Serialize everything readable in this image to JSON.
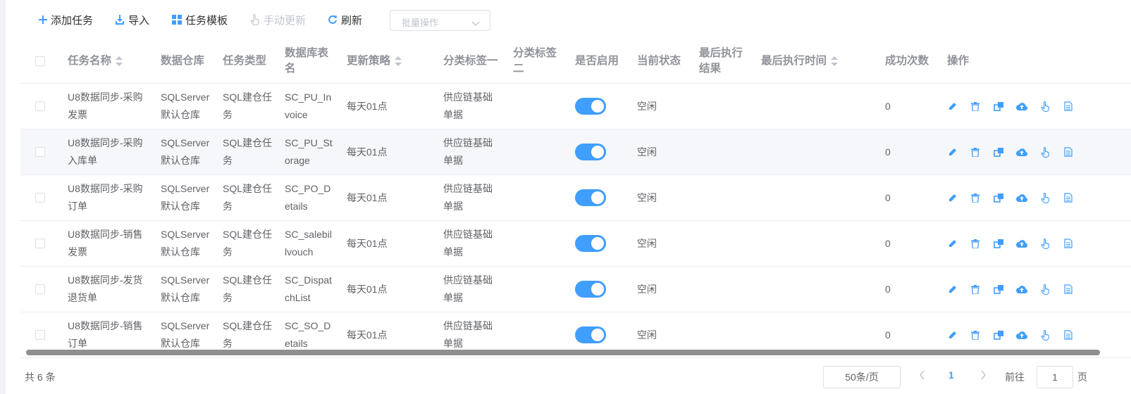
{
  "toolbar": {
    "add_label": "添加任务",
    "import_label": "导入",
    "template_label": "任务模板",
    "manual_update_label": "手动更新",
    "refresh_label": "刷新",
    "batch_placeholder": "批量操作"
  },
  "columns": {
    "task_name": "任务名称",
    "warehouse": "数据仓库",
    "task_type": "任务类型",
    "db_table_1": "数据库表",
    "db_table_2": "名",
    "strategy": "更新策略",
    "tag1": "分类标签一",
    "tag2_1": "分类标签",
    "tag2_2": "二",
    "enabled": "是否启用",
    "status": "当前状态",
    "last_result_1": "最后执行",
    "last_result_2": "结果",
    "last_time": "最后执行时间",
    "success_count": "成功次数",
    "ops": "操作"
  },
  "rows": [
    {
      "name1": "U8数据同步-采购",
      "name2": "发票",
      "wh1": "SQLServer",
      "wh2": "默认仓库",
      "type1": "SQL建仓任",
      "type2": "务",
      "tbl1": "SC_PU_In",
      "tbl2": "voice",
      "strategy": "每天01点",
      "tag1_1": "供应链基础",
      "tag1_2": "单据",
      "enabled": true,
      "status": "空闲",
      "success": "0"
    },
    {
      "name1": "U8数据同步-采购",
      "name2": "入库单",
      "wh1": "SQLServer",
      "wh2": "默认仓库",
      "type1": "SQL建仓任",
      "type2": "务",
      "tbl1": "SC_PU_St",
      "tbl2": "orage",
      "strategy": "每天01点",
      "tag1_1": "供应链基础",
      "tag1_2": "单据",
      "enabled": true,
      "status": "空闲",
      "success": "0"
    },
    {
      "name1": "U8数据同步-采购",
      "name2": "订单",
      "wh1": "SQLServer",
      "wh2": "默认仓库",
      "type1": "SQL建仓任",
      "type2": "务",
      "tbl1": "SC_PO_D",
      "tbl2": "etails",
      "strategy": "每天01点",
      "tag1_1": "供应链基础",
      "tag1_2": "单据",
      "enabled": true,
      "status": "空闲",
      "success": "0"
    },
    {
      "name1": "U8数据同步-销售",
      "name2": "发票",
      "wh1": "SQLServer",
      "wh2": "默认仓库",
      "type1": "SQL建仓任",
      "type2": "务",
      "tbl1": "SC_salebil",
      "tbl2": "lvouch",
      "strategy": "每天01点",
      "tag1_1": "供应链基础",
      "tag1_2": "单据",
      "enabled": true,
      "status": "空闲",
      "success": "0"
    },
    {
      "name1": "U8数据同步-发货",
      "name2": "退货单",
      "wh1": "SQLServer",
      "wh2": "默认仓库",
      "type1": "SQL建仓任",
      "type2": "务",
      "tbl1": "SC_Dispat",
      "tbl2": "chList",
      "strategy": "每天01点",
      "tag1_1": "供应链基础",
      "tag1_2": "单据",
      "enabled": true,
      "status": "空闲",
      "success": "0"
    },
    {
      "name1": "U8数据同步-销售",
      "name2": "订单",
      "wh1": "SQLServer",
      "wh2": "默认仓库",
      "type1": "SQL建仓任",
      "type2": "务",
      "tbl1": "SC_SO_D",
      "tbl2": "etails",
      "strategy": "每天01点",
      "tag1_1": "供应链基础",
      "tag1_2": "单据",
      "enabled": true,
      "status": "空闲",
      "success": "0"
    }
  ],
  "footer": {
    "total": "共 6 条",
    "page_size": "50条/页",
    "current_page": "1",
    "goto_prefix": "前往",
    "goto_value": "1",
    "goto_suffix": "页"
  },
  "colors": {
    "accent": "#409eff",
    "header_text": "#909399",
    "body_text": "#606266"
  }
}
